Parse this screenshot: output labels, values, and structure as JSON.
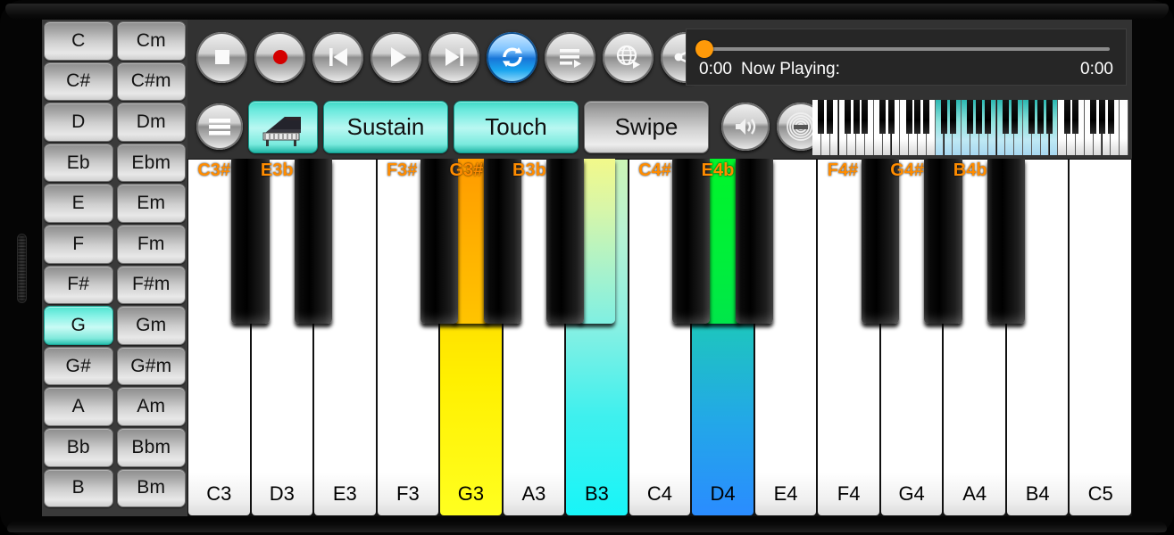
{
  "app": {
    "background_color": "#323232",
    "accent_active": "#4fe3d0",
    "accent_orange": "#ff9a09",
    "label_orange": "#ff8c00"
  },
  "chord_panel": {
    "rows": [
      {
        "major": "C",
        "minor": "Cm",
        "major_active": false,
        "minor_active": false
      },
      {
        "major": "C#",
        "minor": "C#m",
        "major_active": false,
        "minor_active": false
      },
      {
        "major": "D",
        "minor": "Dm",
        "major_active": false,
        "minor_active": false
      },
      {
        "major": "Eb",
        "minor": "Ebm",
        "major_active": false,
        "minor_active": false
      },
      {
        "major": "E",
        "minor": "Em",
        "major_active": false,
        "minor_active": false
      },
      {
        "major": "F",
        "minor": "Fm",
        "major_active": false,
        "minor_active": false
      },
      {
        "major": "F#",
        "minor": "F#m",
        "major_active": false,
        "minor_active": false
      },
      {
        "major": "G",
        "minor": "Gm",
        "major_active": true,
        "minor_active": false
      },
      {
        "major": "G#",
        "minor": "G#m",
        "major_active": false,
        "minor_active": false
      },
      {
        "major": "A",
        "minor": "Am",
        "major_active": false,
        "minor_active": false
      },
      {
        "major": "Bb",
        "minor": "Bbm",
        "major_active": false,
        "minor_active": false
      },
      {
        "major": "B",
        "minor": "Bm",
        "major_active": false,
        "minor_active": false
      }
    ]
  },
  "transport": {
    "buttons": [
      {
        "name": "stop-button",
        "icon": "stop-icon",
        "active": false
      },
      {
        "name": "record-button",
        "icon": "record-icon",
        "active": false
      },
      {
        "name": "previous-button",
        "icon": "previous-icon",
        "active": false
      },
      {
        "name": "play-button",
        "icon": "play-icon",
        "active": false
      },
      {
        "name": "next-button",
        "icon": "next-icon",
        "active": false
      },
      {
        "name": "loop-button",
        "icon": "loop-icon",
        "active": true
      },
      {
        "name": "playlist-button",
        "icon": "playlist-icon",
        "active": false
      },
      {
        "name": "globe-button",
        "icon": "globe-icon",
        "active": false
      },
      {
        "name": "share-button",
        "icon": "share-icon",
        "active": false
      }
    ]
  },
  "playback": {
    "elapsed_time": "0:00",
    "now_playing_label": "Now Playing:",
    "total_time": "0:00",
    "seek_position_percent": 0
  },
  "mode_row": {
    "menu_icon": "hamburger-menu-icon",
    "instrument_button": {
      "icon": "grand-piano-icon",
      "active": true
    },
    "sustain_label": "Sustain",
    "sustain_active": true,
    "touch_label": "Touch",
    "touch_active": true,
    "swipe_label": "Swipe",
    "swipe_active": false,
    "right_icons": [
      {
        "name": "volume-button",
        "icon": "speaker-icon",
        "active": false
      },
      {
        "name": "reverb-button",
        "icon": "reverb-icon",
        "active": false
      },
      {
        "name": "tempo-button",
        "icon": "metronome-icon",
        "active": true
      }
    ]
  },
  "mini_keyboard": {
    "total_white_keys": 36,
    "highlight_start_white_index": 14,
    "highlight_end_white_index": 28
  },
  "keyboard": {
    "white_keys": [
      {
        "label": "C3",
        "highlight": "none"
      },
      {
        "label": "D3",
        "highlight": "none"
      },
      {
        "label": "E3",
        "highlight": "none"
      },
      {
        "label": "F3",
        "highlight": "none"
      },
      {
        "label": "G3",
        "highlight": "yellow"
      },
      {
        "label": "A3",
        "highlight": "none"
      },
      {
        "label": "B3",
        "highlight": "cyan"
      },
      {
        "label": "C4",
        "highlight": "none"
      },
      {
        "label": "D4",
        "highlight": "blue"
      },
      {
        "label": "E4",
        "highlight": "none"
      },
      {
        "label": "F4",
        "highlight": "none"
      },
      {
        "label": "G4",
        "highlight": "none"
      },
      {
        "label": "A4",
        "highlight": "none"
      },
      {
        "label": "B4",
        "highlight": "none"
      },
      {
        "label": "C5",
        "highlight": "none"
      }
    ],
    "black_keys": [
      {
        "label": "C3#",
        "after_white_index": 0,
        "highlight": "none"
      },
      {
        "label": "",
        "after_white_index": 1,
        "highlight": "none",
        "label_hidden": true
      },
      {
        "label": "E3b",
        "after_white_index": 1,
        "highlight": "none"
      },
      {
        "label": "F3#",
        "after_white_index": 3,
        "highlight": "none"
      },
      {
        "label": "",
        "after_white_index": 4,
        "highlight": "orange",
        "label_hidden": true
      },
      {
        "label": "G3#",
        "after_white_index": 4,
        "highlight": "none"
      },
      {
        "label": "B3b",
        "after_white_index": 5,
        "highlight": "none"
      },
      {
        "label": "C4#",
        "after_white_index": 7,
        "highlight": "none"
      },
      {
        "label": "",
        "after_white_index": 8,
        "highlight": "green",
        "label_hidden": true
      },
      {
        "label": "E4b",
        "after_white_index": 8,
        "highlight": "none"
      },
      {
        "label": "F4#",
        "after_white_index": 10,
        "highlight": "none"
      },
      {
        "label": "G4#",
        "after_white_index": 11,
        "highlight": "none"
      },
      {
        "label": "B4b",
        "after_white_index": 12,
        "highlight": "none"
      }
    ]
  }
}
